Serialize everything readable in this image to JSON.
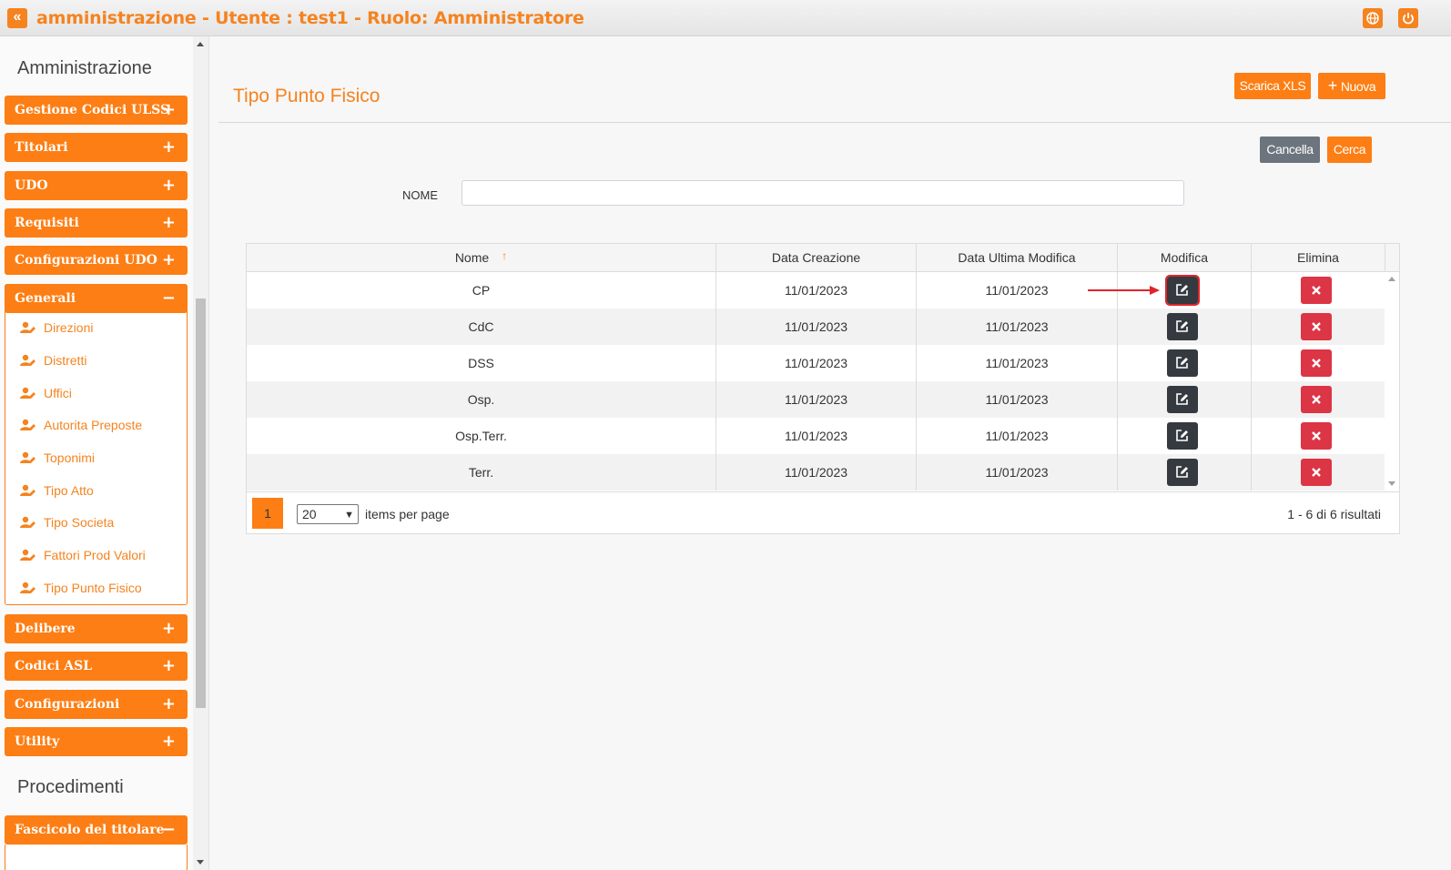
{
  "header": {
    "title": "amministrazione - Utente : test1 - Ruolo: Amministratore"
  },
  "sidebar": {
    "section_admin": "Amministrazione",
    "items": [
      {
        "label": "Gestione Codici ULSS",
        "sign": "+"
      },
      {
        "label": "Titolari",
        "sign": "+"
      },
      {
        "label": "UDO",
        "sign": "+"
      },
      {
        "label": "Requisiti",
        "sign": "+"
      },
      {
        "label": "Configurazioni UDO",
        "sign": "+"
      }
    ],
    "generali": {
      "label": "Generali",
      "sign": "−",
      "sub": [
        "Direzioni",
        "Distretti",
        "Uffici",
        "Autorita Preposte",
        "Toponimi",
        "Tipo Atto",
        "Tipo Societa",
        "Fattori Prod Valori",
        "Tipo Punto Fisico"
      ]
    },
    "items2": [
      {
        "label": "Delibere",
        "sign": "+"
      },
      {
        "label": "Codici ASL",
        "sign": "+"
      },
      {
        "label": "Configurazioni",
        "sign": "+"
      },
      {
        "label": "Utility",
        "sign": "+"
      }
    ],
    "section_proc": "Procedimenti",
    "fascicolo": {
      "label": "Fascicolo del titolare",
      "sign": "−"
    }
  },
  "page": {
    "title": "Tipo Punto Fisico",
    "scarica_label": "Scarica XLS",
    "nuova_label": "Nuova",
    "cancella_label": "Cancella",
    "cerca_label": "Cerca",
    "filter_label": "NOME",
    "filter_value": ""
  },
  "grid": {
    "columns": [
      "Nome",
      "Data Creazione",
      "Data Ultima Modifica",
      "Modifica",
      "Elimina"
    ],
    "sort_indicator": "↑",
    "rows": [
      {
        "nome": "CP",
        "creazione": "11/01/2023",
        "modifica": "11/01/2023"
      },
      {
        "nome": "CdC",
        "creazione": "11/01/2023",
        "modifica": "11/01/2023"
      },
      {
        "nome": "DSS",
        "creazione": "11/01/2023",
        "modifica": "11/01/2023"
      },
      {
        "nome": "Osp.",
        "creazione": "11/01/2023",
        "modifica": "11/01/2023"
      },
      {
        "nome": "Osp.Terr.",
        "creazione": "11/01/2023",
        "modifica": "11/01/2023"
      },
      {
        "nome": "Terr.",
        "creazione": "11/01/2023",
        "modifica": "11/01/2023"
      }
    ],
    "pager": {
      "page": "1",
      "page_size": "20",
      "items_label": "items per page",
      "results": "1 - 6 di 6 risultati"
    }
  },
  "colors": {
    "accent": "#fd7e14",
    "danger": "#dc3545",
    "dark": "#343a40"
  },
  "icons": {
    "back": "double-chevron-left-icon",
    "globe": "globe-icon",
    "power": "power-icon",
    "user_edit": "user-edit-icon",
    "edit": "edit-icon",
    "delete": "times-icon"
  }
}
